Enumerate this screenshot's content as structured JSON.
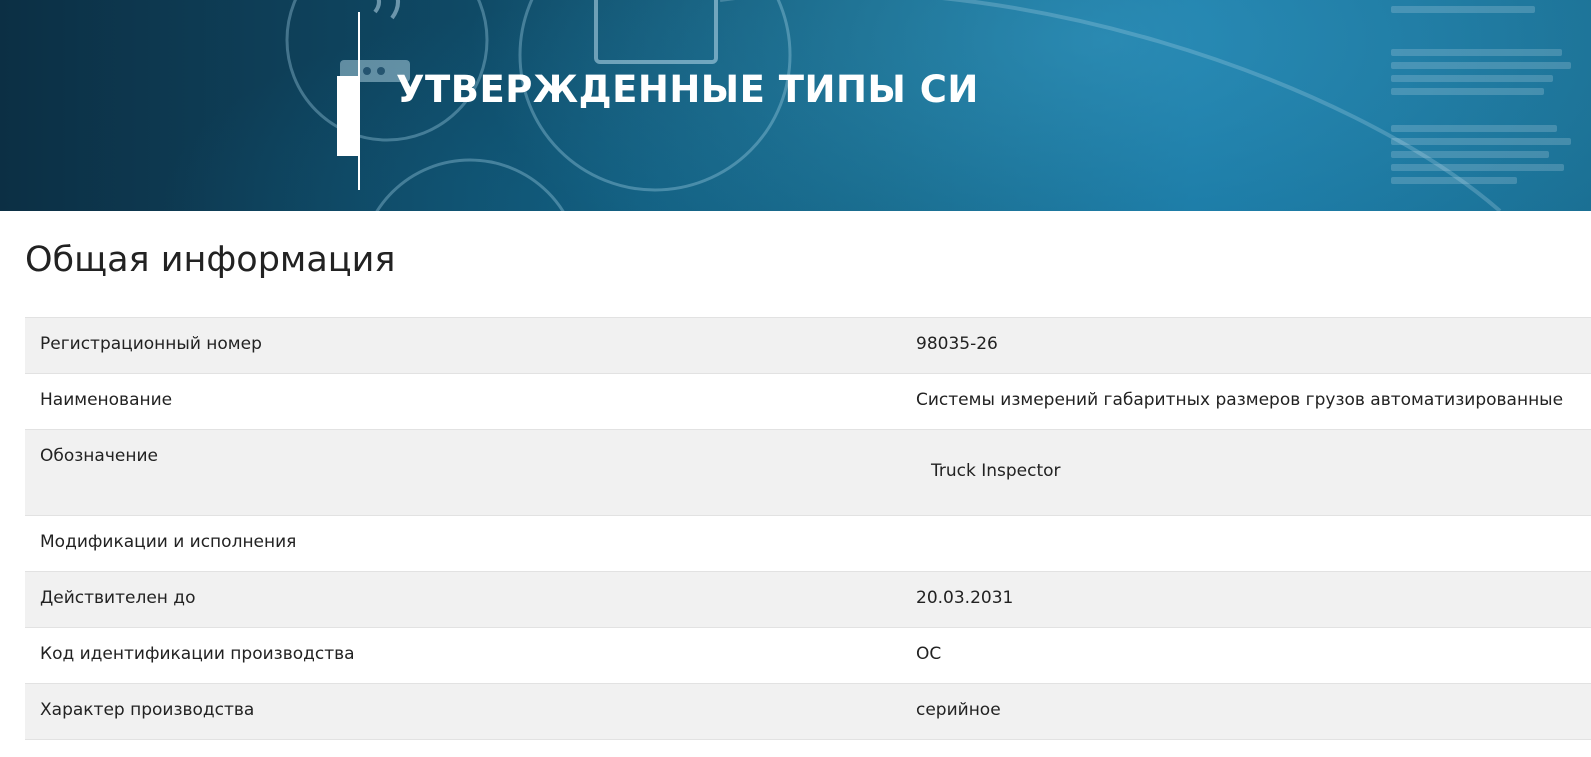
{
  "banner": {
    "title": "УТВЕРЖДЕННЫЕ ТИПЫ СИ"
  },
  "section": {
    "heading": "Общая информация"
  },
  "rows": [
    {
      "label": "Регистрационный номер",
      "value": "98035-26"
    },
    {
      "label": "Наименование",
      "value": "Системы измерений габаритных размеров грузов автоматизированные"
    },
    {
      "label": "Обозначение",
      "value": "Truck Inspector"
    },
    {
      "label": "Модификации и исполнения",
      "value": ""
    },
    {
      "label": "Действителен до",
      "value": "20.03.2031"
    },
    {
      "label": "Код идентификации производства",
      "value": "ОС"
    },
    {
      "label": "Характер производства",
      "value": "серийное"
    }
  ],
  "colors": {
    "banner_dark": "#0c2f44",
    "banner_light": "#1574a0",
    "row_shaded": "#f1f1f1",
    "row_border": "#e2e2e2",
    "text": "#222222"
  }
}
